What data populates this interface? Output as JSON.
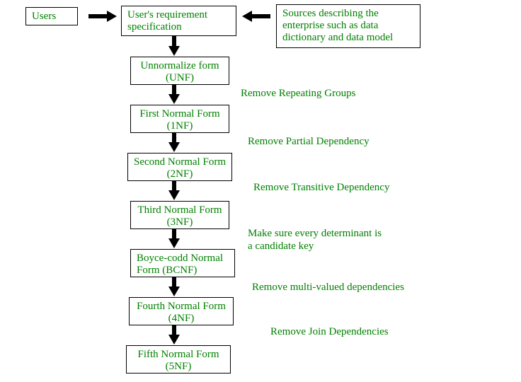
{
  "top": {
    "users": "Users",
    "spec": "User's requirement specification",
    "sources": "Sources describing the enterprise such as data dictionary and data model"
  },
  "steps": {
    "unf": {
      "line1": "Unnormalize form",
      "line2": "(UNF)"
    },
    "nf1": {
      "line1": "First Normal Form",
      "line2": "(1NF)"
    },
    "nf2": {
      "line1": "Second Normal Form",
      "line2": "(2NF)"
    },
    "nf3": {
      "line1": "Third Normal Form",
      "line2": "(3NF)"
    },
    "bcnf": {
      "line1": "Boyce-codd Normal",
      "line2": "Form (BCNF)"
    },
    "nf4": {
      "line1": "Fourth Normal Form",
      "line2": "(4NF)"
    },
    "nf5": {
      "line1": "Fifth Normal Form",
      "line2": "(5NF)"
    }
  },
  "transitions": {
    "t1": "Remove Repeating Groups",
    "t2": "Remove Partial Dependency",
    "t3": "Remove Transitive Dependency",
    "t4a": "Make sure every determinant is",
    "t4b": "a candidate key",
    "t5": "Remove multi-valued dependencies",
    "t6": "Remove Join Dependencies"
  }
}
